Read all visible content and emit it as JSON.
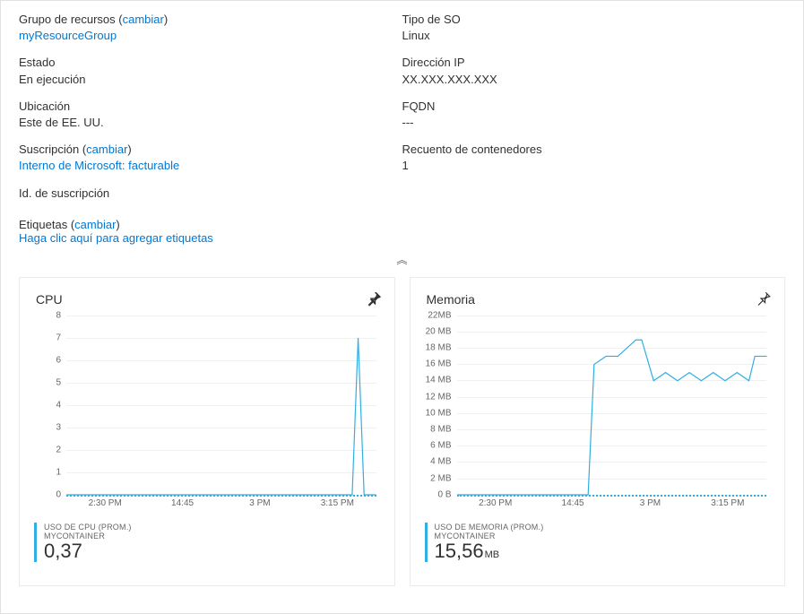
{
  "props": {
    "left": [
      {
        "label": "Grupo de recursos",
        "change": "cambiar",
        "value": "myResourceGroup",
        "link": true
      },
      {
        "label": "Estado",
        "value": "En ejecución"
      },
      {
        "label": "Ubicación",
        "value": "Este de EE. UU."
      },
      {
        "label": "Suscripción",
        "change": "cambiar",
        "value": "Interno de Microsoft: facturable",
        "link": true
      },
      {
        "label": "Id. de suscripción",
        "value": ""
      }
    ],
    "right": [
      {
        "label": "Tipo de SO",
        "value": "Linux"
      },
      {
        "label": "Dirección IP",
        "value": "XX.XXX.XXX.XXX"
      },
      {
        "label": "FQDN",
        "value": "---"
      },
      {
        "label": "Recuento de contenedores",
        "value": "1"
      }
    ]
  },
  "tags": {
    "label": "Etiquetas",
    "change": "cambiar",
    "action": "Haga clic aquí para agregar etiquetas"
  },
  "collapse_glyph": "︽",
  "charts": {
    "cpu": {
      "title": "CPU",
      "legend_top": "USO DE CPU (PROM.)",
      "legend_sub": "MYCONTAINER",
      "legend_value": "0,37",
      "legend_unit": ""
    },
    "mem": {
      "title": "Memoria",
      "legend_top": "USO DE MEMORIA (PROM.)",
      "legend_sub": "MYCONTAINER",
      "legend_value": "15,56",
      "legend_unit": "MB"
    }
  },
  "chart_data": [
    {
      "type": "line",
      "title": "CPU",
      "ylabel": "",
      "xlabel": "",
      "ylim": [
        0,
        8
      ],
      "yticks": [
        0,
        1,
        2,
        3,
        4,
        5,
        6,
        7,
        8
      ],
      "xticks": [
        "2:30 PM",
        "14:45",
        "3 PM",
        "3:15 PM"
      ],
      "series": [
        {
          "name": "USO DE CPU (PROM.) MYCONTAINER",
          "x_minutes": [
            0,
            5,
            10,
            15,
            20,
            25,
            30,
            35,
            40,
            45,
            48,
            49,
            50,
            51,
            52
          ],
          "values": [
            0,
            0,
            0,
            0,
            0,
            0,
            0,
            0,
            0,
            0,
            0,
            7,
            0,
            0,
            0
          ]
        }
      ]
    },
    {
      "type": "line",
      "title": "Memoria",
      "ylabel": "",
      "xlabel": "",
      "ylim": [
        0,
        22
      ],
      "yunit": "MB",
      "yticks": [
        "0 B",
        "2 MB",
        "4 MB",
        "6 MB",
        "8 MB",
        "10 MB",
        "12 MB",
        "14 MB",
        "16 MB",
        "18 MB",
        "20 MB",
        "22MB"
      ],
      "ytick_values": [
        0,
        2,
        4,
        6,
        8,
        10,
        12,
        14,
        16,
        18,
        20,
        22
      ],
      "xticks": [
        "2:30 PM",
        "14:45",
        "3 PM",
        "3:15 PM"
      ],
      "series": [
        {
          "name": "USO DE MEMORIA (PROM.) MYCONTAINER",
          "x_minutes": [
            0,
            5,
            10,
            15,
            20,
            22,
            23,
            25,
            27,
            30,
            31,
            33,
            35,
            37,
            39,
            41,
            43,
            45,
            47,
            49,
            50,
            52
          ],
          "values": [
            0,
            0,
            0,
            0,
            0,
            0,
            16,
            17,
            17,
            19,
            19,
            14,
            15,
            14,
            15,
            14,
            15,
            14,
            15,
            14,
            17,
            17
          ]
        }
      ]
    }
  ]
}
